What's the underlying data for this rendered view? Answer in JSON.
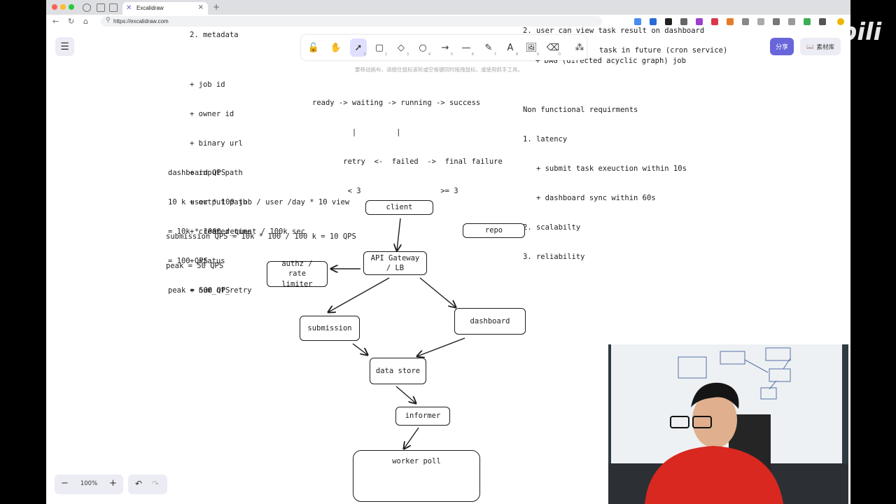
{
  "browser": {
    "tab_title": "Excalidraw",
    "url": "https://excalidraw.com",
    "new_tab": "+",
    "tab_close": "×"
  },
  "toolbar": {
    "tools": [
      {
        "name": "lock-tool",
        "glyph": "🔓",
        "key": ""
      },
      {
        "name": "hand-tool",
        "glyph": "✋",
        "key": ""
      },
      {
        "name": "selection-tool",
        "glyph": "➚",
        "key": "1"
      },
      {
        "name": "rectangle-tool",
        "glyph": "▢",
        "key": "2"
      },
      {
        "name": "diamond-tool",
        "glyph": "◇",
        "key": "3"
      },
      {
        "name": "ellipse-tool",
        "glyph": "○",
        "key": "4"
      },
      {
        "name": "arrow-tool",
        "glyph": "→",
        "key": "5"
      },
      {
        "name": "line-tool",
        "glyph": "—",
        "key": "6"
      },
      {
        "name": "draw-tool",
        "glyph": "✎",
        "key": "7"
      },
      {
        "name": "text-tool",
        "glyph": "A",
        "key": "8"
      },
      {
        "name": "image-tool",
        "glyph": "🖼",
        "key": "9"
      },
      {
        "name": "eraser-tool",
        "glyph": "⌫",
        "key": "0"
      },
      {
        "name": "more-tools",
        "glyph": "⁂",
        "key": ""
      }
    ],
    "hint": "要移动画布，请按住鼠标滚轮或空格键同时拖拽鼠标，或使用抓手工具。"
  },
  "top_right": {
    "share_label": "分享",
    "library_label": "素材库"
  },
  "footer": {
    "zoom_value": "100%",
    "zoom_out": "−",
    "zoom_in": "+",
    "undo": "↶",
    "redo": "↷"
  },
  "notes": {
    "metadata": "2. metadata",
    "fields": [
      "+ job id",
      "+ owner id",
      "+ binary url",
      "+ input path",
      "+ output path",
      "+ created_time",
      "+ status",
      "+ num_of_retry"
    ],
    "states_line1": "ready -> waiting -> running -> success",
    "states_line2": "         |         |",
    "states_line3": "       retry  <-  failed  ->  final failure",
    "states_line4": "        < 3                  >= 3",
    "dashboard_qps": [
      "dashboard QPS",
      "10 k user * 100 job / user /day * 10 view",
      "= 10k * 1000 request / 100k sec",
      "= 100 QPS",
      "peak = 500 QPS"
    ],
    "submission_qps": [
      "submission QPS = 10k * 100 / 100 k = 10 QPS",
      "peak = 50 QPS"
    ],
    "fr_line2": "2. user can view task result on dashboard",
    "fr_cron": "task in future (cron service)",
    "fr_dag": "+ DAG (directed acyclic graph) job",
    "nfr": [
      "Non functional requirments",
      "1. latency",
      "   + submit task exeuction within 10s",
      "   + dashboard sync within 60s",
      "2. scalabilty",
      "3. reliability"
    ]
  },
  "diagram": {
    "client": "client",
    "repo": "repo",
    "gateway": "API Gateway / LB",
    "authz": "authz / rate limiter",
    "submission": "submission",
    "dashboard": "dashboard",
    "data_store": "data store",
    "informer": "informer",
    "worker": "worker poll"
  }
}
